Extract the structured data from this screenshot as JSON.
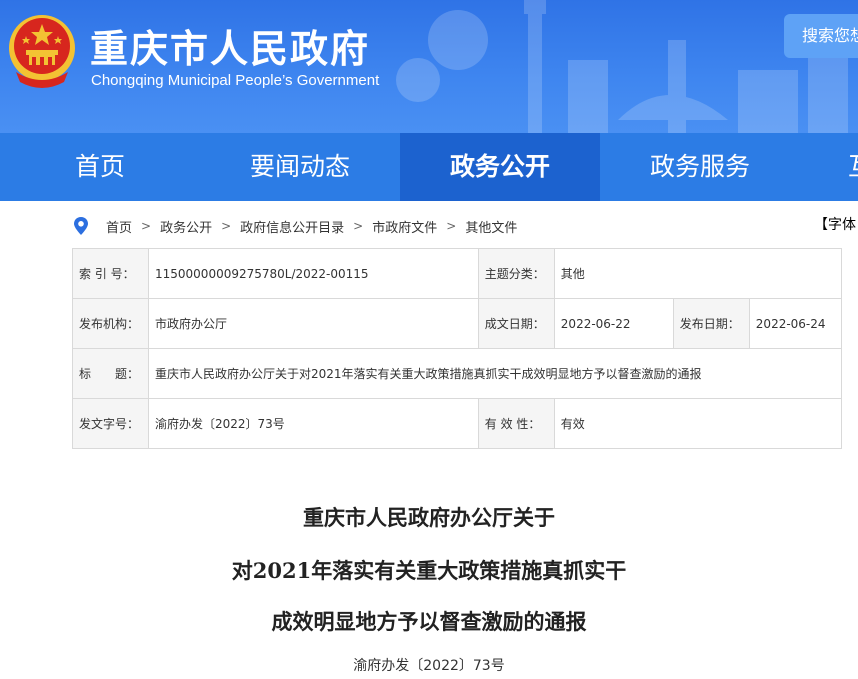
{
  "header": {
    "title": "重庆市人民政府",
    "subtitle": "Chongqing Municipal People’s Government",
    "search_label": "搜索您想"
  },
  "nav": {
    "items": [
      "首页",
      "要闻动态",
      "政务公开",
      "政务服务",
      "互"
    ],
    "active_index": 2
  },
  "breadcrumb": {
    "items": [
      "首页",
      "政务公开",
      "政府信息公开目录",
      "市政府文件",
      "其他文件"
    ],
    "separator": ">"
  },
  "font_control": "【字体",
  "info": {
    "index_label": "索 引 号：",
    "index_value": "11500000009275780L/2022-00115",
    "topic_label": "主题分类：",
    "topic_value": "其他",
    "org_label": "发布机构：",
    "org_value": "市政府办公厅",
    "created_label": "成文日期：",
    "created_value": "2022-06-22",
    "published_label": "发布日期：",
    "published_value": "2022-06-24",
    "title_label": "标　　题：",
    "title_value": "重庆市人民政府办公厅关于对2021年落实有关重大政策措施真抓实干成效明显地方予以督查激励的通报",
    "docno_label": "发文字号：",
    "docno_value": "渝府办发〔2022〕73号",
    "validity_label": "有 效 性：",
    "validity_value": "有效"
  },
  "document": {
    "title_lines": [
      "重庆市人民政府办公厅关于",
      "对2021年落实有关重大政策措施真抓实干",
      "成效明显地方予以督查激励的通报"
    ],
    "doc_number": "渝府办发〔2022〕73号"
  },
  "colors": {
    "header_blue": "#3f86f0",
    "nav_blue": "#2c7ce5",
    "nav_active": "#1c62cf",
    "emblem_red": "#d7261e",
    "emblem_gold": "#f3c233"
  }
}
